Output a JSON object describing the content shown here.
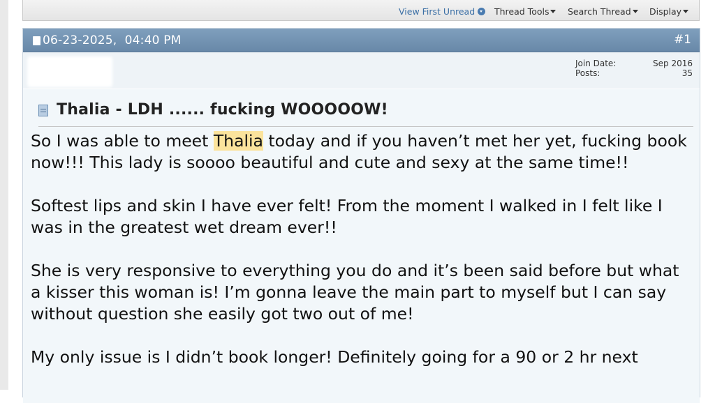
{
  "toolbar": {
    "view_first_unread": "View First Unread",
    "thread_tools": "Thread Tools",
    "search_thread": "Search Thread",
    "display": "Display"
  },
  "post": {
    "date": "06-23-2025,",
    "time": "04:40 PM",
    "number": "#1",
    "user": {
      "join_date_label": "Join Date:",
      "join_date": "Sep 2016",
      "posts_label": "Posts:",
      "posts": "35"
    },
    "title": "Thalia - LDH ...... fucking WOOOOOW!",
    "highlight_color": "#fbe39c",
    "paragraphs": [
      {
        "before": "So I was able to meet ",
        "highlight": "Thalia",
        "after": " today and if you haven’t met her yet, fucking book now!!! This lady is soooo beautiful and cute and sexy at the same time!!"
      },
      {
        "text": "Softest lips and skin I have ever felt! From the moment I walked in I felt like I was in the greatest wet dream ever!!"
      },
      {
        "text": "She is very responsive to everything you do and it’s been said before but what a kisser this woman is! I’m gonna leave the main part to myself but I can say without question she easily got two out of me!"
      },
      {
        "text": "My only issue is I didn’t book longer! Definitely going for a 90 or 2 hr next"
      }
    ]
  },
  "icons": {
    "post_icon": "document-icon",
    "title_icon": "document-lines-icon",
    "unread_icon": "info-icon"
  }
}
